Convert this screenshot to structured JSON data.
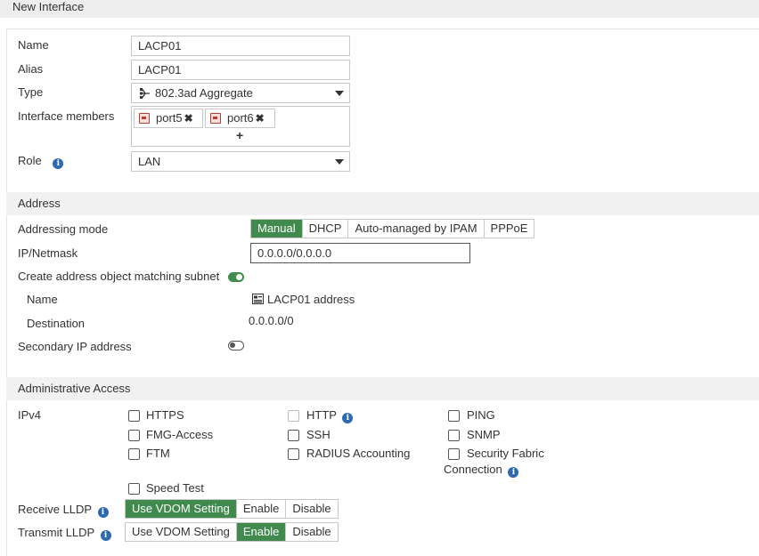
{
  "window": {
    "title": "New Interface"
  },
  "general": {
    "name_label": "Name",
    "name_value": "LACP01",
    "alias_label": "Alias",
    "alias_value": "LACP01",
    "type_label": "Type",
    "type_value": "802.3ad Aggregate",
    "type_icon": "aggregate-icon",
    "members_label": "Interface members",
    "members": [
      {
        "label": "port5",
        "icon": "port-icon"
      },
      {
        "label": "port6",
        "icon": "port-icon"
      }
    ],
    "add_member": "+",
    "role_label": "Role",
    "role_value": "LAN"
  },
  "address": {
    "section_title": "Address",
    "mode_label": "Addressing mode",
    "modes": [
      "Manual",
      "DHCP",
      "Auto-managed by IPAM",
      "PPPoE"
    ],
    "selected_mode": "Manual",
    "ip_label": "IP/Netmask",
    "ip_value": "0.0.0.0/0.0.0.0",
    "create_object_label": "Create address object matching subnet",
    "create_object_on": true,
    "obj_name_label": "Name",
    "obj_name_value": "LACP01 address",
    "destination_label": "Destination",
    "destination_value": "0.0.0.0/0",
    "secondary_label": "Secondary IP address",
    "secondary_on": false
  },
  "admin": {
    "section_title": "Administrative Access",
    "ipv4_label": "IPv4",
    "protocols": [
      {
        "label": "HTTPS",
        "checked": false,
        "disabled": false
      },
      {
        "label": "HTTP",
        "checked": false,
        "disabled": true,
        "info": true
      },
      {
        "label": "PING",
        "checked": false,
        "disabled": false
      },
      {
        "label": "FMG-Access",
        "checked": false,
        "disabled": false
      },
      {
        "label": "SSH",
        "checked": false,
        "disabled": false
      },
      {
        "label": "SNMP",
        "checked": false,
        "disabled": false
      },
      {
        "label": "FTM",
        "checked": false,
        "disabled": false
      },
      {
        "label": "RADIUS Accounting",
        "checked": false,
        "disabled": false
      },
      {
        "label": "Security Fabric",
        "label2": "Connection",
        "checked": false,
        "disabled": false,
        "info": true
      },
      {
        "label": "Speed Test",
        "checked": false,
        "disabled": false
      }
    ],
    "receive_lldp_label": "Receive LLDP",
    "transmit_lldp_label": "Transmit LLDP",
    "lldp_options": [
      "Use VDOM Setting",
      "Enable",
      "Disable"
    ],
    "receive_selected": "Use VDOM Setting",
    "transmit_selected": "Enable"
  },
  "colors": {
    "accent": "#3f8a4c",
    "info": "#2d6ab0",
    "port": "#c0392b"
  }
}
